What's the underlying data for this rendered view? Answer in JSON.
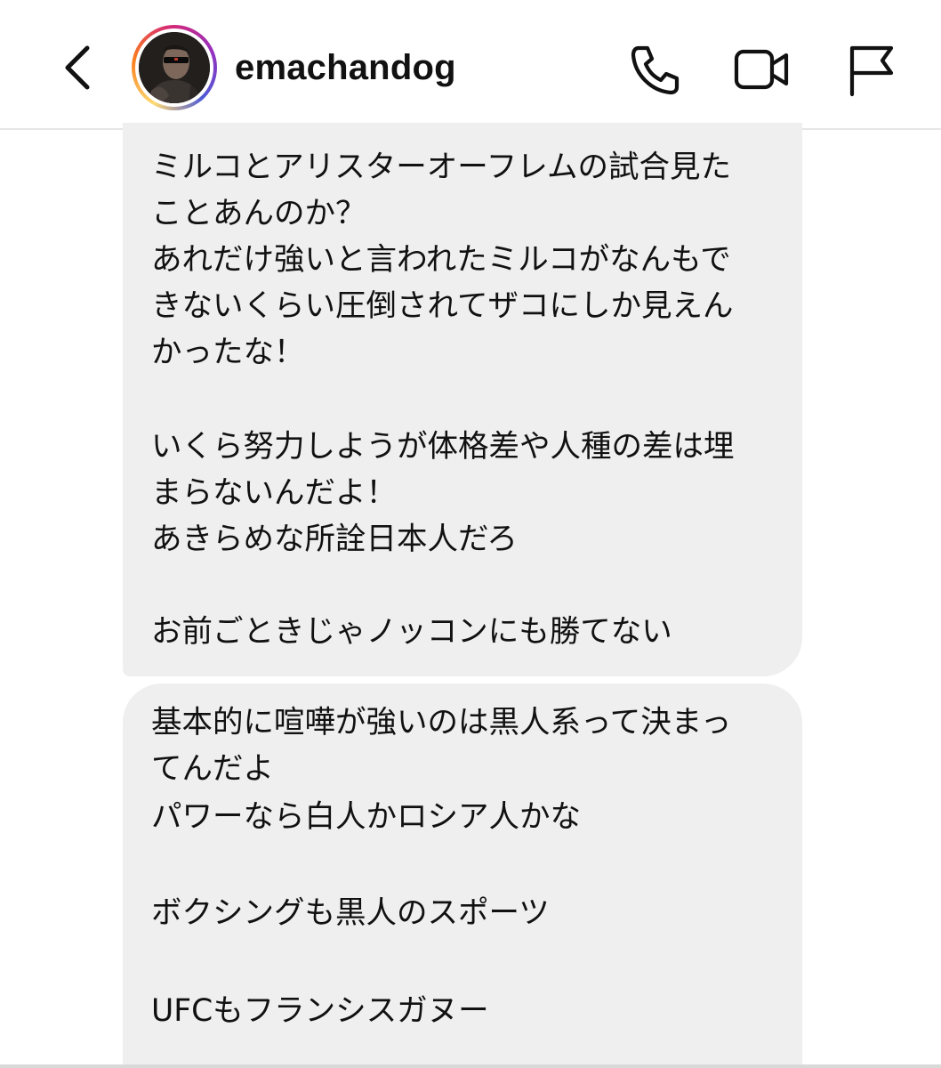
{
  "header": {
    "username": "emachandog"
  },
  "icons": {
    "back": "chevron-left-icon",
    "call": "phone-icon",
    "video": "video-camera-icon",
    "flag": "flag-icon"
  },
  "colors": {
    "bubble_bg": "#efefef",
    "text": "#111111",
    "ring_gradient": [
      "#feda75",
      "#fa7e1e",
      "#d62976",
      "#962fbf",
      "#4f5bd5"
    ]
  },
  "messages": [
    {
      "lines": [
        "ミルコとアリスターオーフレムの試合見た",
        "ことあんのか？",
        "あれだけ強いと言われたミルコがなんもで",
        "きないくらい圧倒されてザコにしか見えん",
        "かったな！",
        "",
        "いくら努力しようが体格差や人種の差は埋",
        "まらないんだよ！",
        "あきらめな所詮日本人だろ",
        "",
        "お前ごときじゃノッコンにも勝てない"
      ]
    },
    {
      "lines": [
        "基本的に喧嘩が強いのは黒人系って決まっ",
        "てんだよ",
        "パワーなら白人かロシア人かな",
        "",
        "ボクシングも黒人のスポーツ",
        "",
        "UFCもフランシスガヌー"
      ]
    }
  ]
}
